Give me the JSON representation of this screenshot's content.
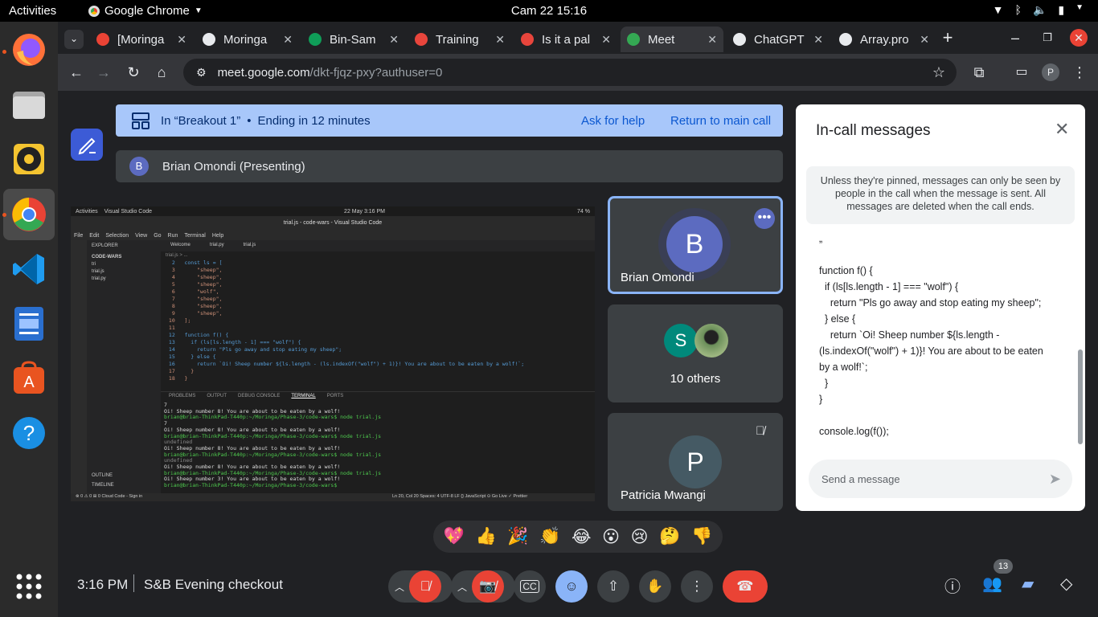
{
  "os": {
    "activities": "Activities",
    "app_name": "Google Chrome",
    "clock": "Cam 22  15:16"
  },
  "chrome": {
    "tabs": [
      {
        "title": "[Moringa",
        "color": "#ea4335"
      },
      {
        "title": "Moringa",
        "color": "#e8eaed"
      },
      {
        "title": "Bin-Sam",
        "color": "#0f9d58"
      },
      {
        "title": "Training",
        "color": "#e8453c"
      },
      {
        "title": "Is it a pal",
        "color": "#e8453c"
      },
      {
        "title": "Meet",
        "color": "#34a853"
      },
      {
        "title": "ChatGPT",
        "color": "#e8eaed"
      },
      {
        "title": "Array.pro",
        "color": "#e8eaed"
      }
    ],
    "url_host": "meet.google.com",
    "url_path": "/dkt-fjqz-pxy?authuser=0",
    "profile_initial": "P"
  },
  "meet": {
    "breakout_room": "In “Breakout 1”",
    "breakout_separator": "•",
    "breakout_timer": "Ending in 12 minutes",
    "ask_for_help": "Ask for help",
    "return_main": "Return to main call",
    "presenter_initial": "B",
    "presenter_label": "Brian Omondi (Presenting)",
    "tiles": [
      {
        "name": "Brian Omondi",
        "initial": "B",
        "color": "#5c6bc0"
      },
      {
        "name": "10 others",
        "initial": "S",
        "color": "#00897b"
      },
      {
        "name": "Patricia Mwangi",
        "initial": "P",
        "color": "#455a64"
      }
    ],
    "meeting_time": "3:16 PM",
    "meeting_name": "S&B Evening checkout",
    "participants_count": "13",
    "reactions": [
      "💖",
      "👍",
      "🎉",
      "👏",
      "😂",
      "😮",
      "😢",
      "🤔",
      "👎"
    ],
    "accent": "#8ab4f8",
    "danger": "#ea4335"
  },
  "panel": {
    "title": "In-call messages",
    "notice": "Unless they're pinned, messages can only be seen by people in the call when the message is sent. All messages are deleted when the call ends.",
    "message_lines": [
      "„",
      "",
      "function f() {",
      "  if (ls[ls.length - 1] === \"wolf\") {",
      "    return \"Pls go away and stop eating my sheep\";",
      "  } else {",
      "    return `Oi! Sheep number ${ls.length -",
      "(ls.indexOf(\"wolf\") + 1)}! You are about to be eaten",
      "by a wolf!`;",
      "  }",
      "}",
      "",
      "console.log(f());"
    ],
    "input_placeholder": "Send a message"
  },
  "shared_screen": {
    "top_activities": "Activities",
    "top_app": "Visual Studio Code",
    "top_clock": "22 May  3:16 PM",
    "top_battery": "74 %",
    "window_title": "trial.js - code-wars - Visual Studio Code",
    "menu": [
      "File",
      "Edit",
      "Selection",
      "View",
      "Go",
      "Run",
      "Terminal",
      "Help"
    ],
    "explorer_title": "EXPLORER",
    "folder": "CODE-WARS",
    "files": [
      "tri",
      "trial.js",
      "trial.py"
    ],
    "editor_tabs": [
      "Welcome",
      "trial.py",
      "trial.js"
    ],
    "breadcrumb": "trial.js > ...",
    "code_lines": [
      "const ls = [",
      "    \"sheep\",",
      "    \"sheep\",",
      "    \"sheep\",",
      "    \"wolf\",",
      "    \"sheep\",",
      "    \"sheep\",",
      "    \"sheep\",",
      "];",
      "",
      "function f() {",
      "  if (ls[ls.length - 1] === \"wolf\") {",
      "    return \"Pls go away and stop eating my sheep\";",
      "  } else {",
      "    return `Oi! Sheep number ${ls.length - (ls.indexOf(\"wolf\") + 1)}! You are about to be eaten by a wolf!`;",
      "  }",
      "}"
    ],
    "panel_tabs": [
      "PROBLEMS",
      "OUTPUT",
      "DEBUG CONSOLE",
      "TERMINAL",
      "PORTS"
    ],
    "terminal_lines": [
      "7",
      "Oi! Sheep number 8! You are about to be eaten by a wolf!",
      "brian@brian-ThinkPad-T440p:~/Moringa/Phase-3/code-wars$ node trial.js",
      "7",
      "Oi! Sheep number 8! You are about to be eaten by a wolf!",
      "brian@brian-ThinkPad-T440p:~/Moringa/Phase-3/code-wars$ node trial.js",
      "undefined",
      "Oi! Sheep number 8! You are about to be eaten by a wolf!",
      "brian@brian-ThinkPad-T440p:~/Moringa/Phase-3/code-wars$ node trial.js",
      "undefined",
      "Oi! Sheep number 8! You are about to be eaten by a wolf!",
      "brian@brian-ThinkPad-T440p:~/Moringa/Phase-3/code-wars$ node trial.js",
      "Oi! Sheep number 3! You are about to be eaten by a wolf!",
      "brian@brian-ThinkPad-T440p:~/Moringa/Phase-3/code-wars$ "
    ],
    "outline": "OUTLINE",
    "timeline": "TIMELINE",
    "status_left": "⊗ 0 ⚠ 0   ⊞ 0   Cloud Code - Sign in",
    "status_right": "Ln 20, Col 20   Spaces: 4   UTF-8   LF   {} JavaScript   ⊙ Go Live   ✓ Prettier"
  }
}
